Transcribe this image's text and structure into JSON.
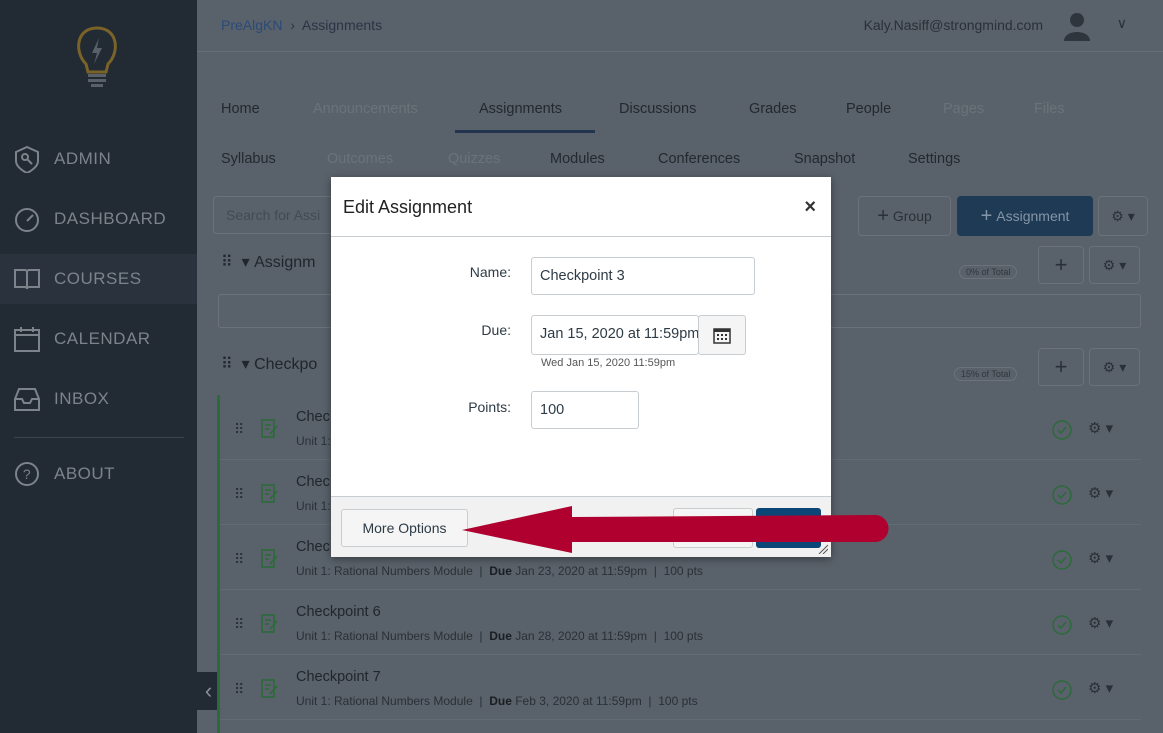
{
  "sidebar": {
    "items": [
      {
        "label": "ADMIN",
        "icon": "shield-icon"
      },
      {
        "label": "DASHBOARD",
        "icon": "speedometer-icon"
      },
      {
        "label": "COURSES",
        "icon": "book-icon",
        "active": true
      },
      {
        "label": "CALENDAR",
        "icon": "calendar-icon"
      },
      {
        "label": "INBOX",
        "icon": "inbox-icon"
      },
      {
        "label": "ABOUT",
        "icon": "question-icon"
      }
    ]
  },
  "header": {
    "breadcrumb": [
      "PreAlgKN",
      "Assignments"
    ],
    "user": "Kaly.Nasiff@strongmind.com"
  },
  "tabs": [
    {
      "label": "Home"
    },
    {
      "label": "Announcements",
      "disabled": true
    },
    {
      "label": "Assignments",
      "active": true
    },
    {
      "label": "Discussions"
    },
    {
      "label": "Grades"
    },
    {
      "label": "People"
    },
    {
      "label": "Pages",
      "disabled": true
    },
    {
      "label": "Files",
      "disabled": true
    },
    {
      "label": "Syllabus"
    },
    {
      "label": "Outcomes",
      "disabled": true
    },
    {
      "label": "Quizzes",
      "disabled": true
    },
    {
      "label": "Modules"
    },
    {
      "label": "Conferences"
    },
    {
      "label": "Snapshot"
    },
    {
      "label": "Settings"
    }
  ],
  "toolbar": {
    "search_placeholder": "Search for Assi",
    "group_label": "Group",
    "assignment_label": "Assignment"
  },
  "groups": [
    {
      "name": "Assignm",
      "pct": "0% of Total"
    },
    {
      "name": "Checkpo",
      "pct": "15% of Total"
    }
  ],
  "rows": [
    {
      "title": "Chec",
      "meta": "Unit 1:",
      "due": "",
      "pts": ""
    },
    {
      "title": "Chec",
      "meta": "Unit 1:",
      "due": "",
      "pts": ""
    },
    {
      "title": "Chec",
      "meta": "Unit 1: Rational Numbers Module",
      "due": "Jan 23, 2020 at 11:59pm",
      "pts": "100 pts"
    },
    {
      "title": "Checkpoint 6",
      "meta": "Unit 1: Rational Numbers Module",
      "due": "Jan 28, 2020 at 11:59pm",
      "pts": "100 pts"
    },
    {
      "title": "Checkpoint 7",
      "meta": "Unit 1: Rational Numbers Module",
      "due": "Feb 3, 2020 at 11:59pm",
      "pts": "100 pts"
    }
  ],
  "due_label": "Due",
  "dialog": {
    "title": "Edit Assignment",
    "name_label": "Name:",
    "name_value": "Checkpoint 3",
    "due_label": "Due:",
    "due_value": "Jan 15, 2020 at 11:59pm",
    "due_hint": "Wed Jan 15, 2020 11:59pm",
    "points_label": "Points:",
    "points_value": "100",
    "more_options": "More Options"
  },
  "colors": {
    "annotation_arrow": "#b0002f",
    "save_button": "#0b4677",
    "accent_logo": "#8a6d2b"
  }
}
